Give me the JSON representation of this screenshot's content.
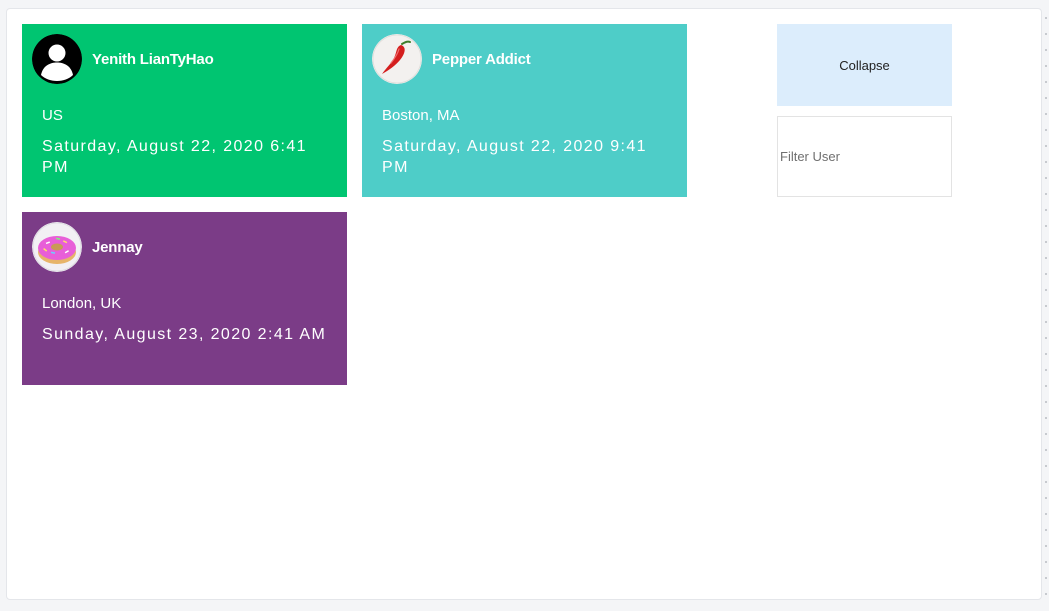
{
  "cards": [
    {
      "username": "Yenith LianTyHao",
      "location": "US",
      "datetime": "Saturday, August 22, 2020 6:41 PM",
      "color": "#00c571",
      "avatar_icon": "default-user-icon"
    },
    {
      "username": "Pepper Addict",
      "location": "Boston, MA",
      "datetime": "Saturday, August 22, 2020 9:41 PM",
      "color": "#4ecdc8",
      "avatar_icon": "chili-pepper-icon"
    },
    {
      "username": "Jennay",
      "location": "London, UK",
      "datetime": "Sunday, August 23, 2020 2:41 AM",
      "color": "#7b3c87",
      "avatar_icon": "donut-icon"
    }
  ],
  "controls": {
    "collapse_label": "Collapse",
    "filter_placeholder": "Filter User",
    "filter_value": ""
  },
  "colors": {
    "collapse_bg": "#dcedfc",
    "page_bg": "#f4f5f7"
  }
}
